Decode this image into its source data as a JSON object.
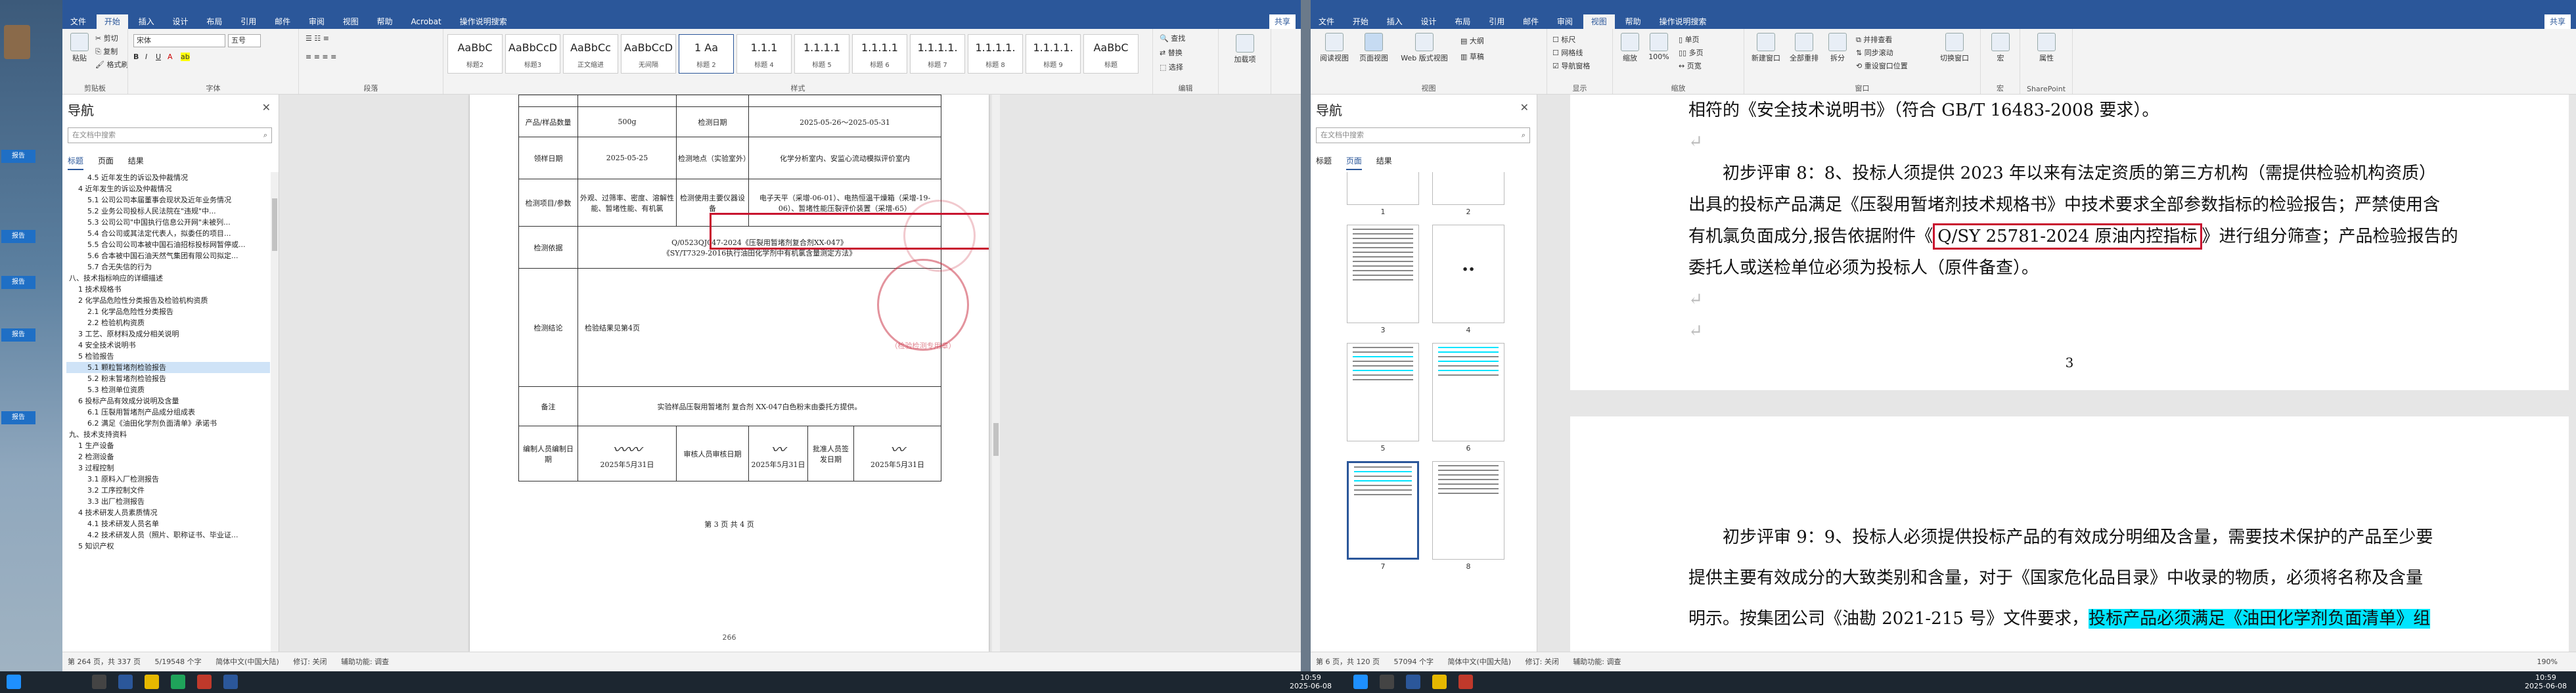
{
  "left_window": {
    "title_left": "",
    "title_right": "",
    "menu": [
      "文件",
      "开始",
      "插入",
      "设计",
      "布局",
      "引用",
      "邮件",
      "审阅",
      "视图",
      "帮助",
      "Acrobat",
      "操作说明搜索"
    ],
    "active_menu": "开始",
    "share": "共享",
    "clipboard": {
      "paste": "粘贴",
      "cut": "剪切",
      "copy": "复制",
      "format_painter": "格式刷",
      "label": "剪贴板"
    },
    "font": {
      "name": "宋体",
      "size": "五号",
      "label": "字体"
    },
    "paragraph_label": "段落",
    "styles": [
      {
        "sample": "AaBbC",
        "name": "标题2"
      },
      {
        "sample": "AaBbCcD",
        "name": "标题3"
      },
      {
        "sample": "AaBbCc",
        "name": "正文缩进"
      },
      {
        "sample": "AaBbCcD",
        "name": "无间隔"
      },
      {
        "sample": "1  Aa",
        "name": "标题 2"
      },
      {
        "sample": "1.1.1",
        "name": "标题 4"
      },
      {
        "sample": "1.1.1.1",
        "name": "标题 5"
      },
      {
        "sample": "1.1.1.1",
        "name": "标题 6"
      },
      {
        "sample": "1.1.1.1.",
        "name": "标题 7"
      },
      {
        "sample": "1.1.1.1.",
        "name": "标题 8"
      },
      {
        "sample": "1.1.1.1.",
        "name": "标题 9"
      },
      {
        "sample": "AaBbC",
        "name": "标题"
      }
    ],
    "styles_label": "样式",
    "editing": {
      "find": "查找",
      "replace": "替换",
      "select": "选择",
      "label": "编辑"
    },
    "addin": {
      "label": "加载项"
    },
    "nav": {
      "title": "导航",
      "search_placeholder": "在文档中搜索",
      "tabs": [
        "标题",
        "页面",
        "结果"
      ],
      "active_tab": "标题",
      "items": [
        "4.5 近年发生的诉讼及仲裁情况",
        "4 近年发生的诉讼及仲裁情况",
        "5.1 公司公司本届董事会现状及近年业务情况",
        "5.2 业务公司投标人民法院在\"违规\"中...",
        "5.3 公司公司\"中国执行信息公开网\"未被列...",
        "5.4 合公司或其法定代表人，拟委任的项目...",
        "5.5 合公司公司本被中国石油招标投标网暂停或...",
        "5.6 合本被中国石油天然气集团有限公司拟定...",
        "5.7 合无失信的行为",
        "八、技术指标响应的详细描述",
        "1 技术规格书",
        "2 化学品危险性分类报告及检验机构资质",
        "2.1 化学品危险性分类报告",
        "2.2 检验机构资质",
        "3 工艺、原材料及成分相关说明",
        "4 安全技术说明书",
        "5 检验报告",
        "5.1 颗粒暂堵剂检验报告",
        "5.2 粉末暂堵剂检验报告",
        "5.3 检测单位资质",
        "6 投标产品有效成分说明及含量",
        "6.1 压裂用暂堵剂产品成分组成表",
        "6.2 满足《油田化学剂负面清单》承诺书",
        "九、技术支持资料",
        "1 生产设备",
        "2 检测设备",
        "3 过程控制",
        "3.1 原料入厂检测报告",
        "3.2 工序控制文件",
        "3.3 出厂检测报告",
        "4 技术研发人员素质情况",
        "4.1 技术研发人员名单",
        "4.2 技术研发人员（照片、职称证书、毕业证...",
        "5 知识产权"
      ],
      "selected_index": 17
    },
    "report": {
      "rows": [
        {
          "c1": "产品/样品数量",
          "c2": "500g",
          "c3": "检测日期",
          "c4": "2025-05-26～2025-05-31"
        },
        {
          "c1": "领样日期",
          "c2": "2025-05-25",
          "c3": "检测地点（实验室外）",
          "c4": "化学分析室内、安监心流动模拟评价室内"
        },
        {
          "c1": "检测项目/参数",
          "c2": "外观、过筛率、密度、溶解性能、暂堵性能、有机氯",
          "c3": "检测使用主要仪器设备",
          "c4": "电子天平（采增-06-01）、电热恒温干燥箱（采增-19-06）、暂堵性能压裂评价装置（采增-65）"
        },
        {
          "c1": "检测依据",
          "c2": "Q/0523QJ047-2024《压裂用暂堵剂复合剂XX-047》",
          "c2b": "《SY/T7329-2016执行油田化学剂中有机氯含量测定方法》"
        },
        {
          "c1": "检测结论",
          "c2": "检验结果见第4页"
        },
        {
          "c1": "备注",
          "c2": "实验样品压裂用暂堵剂 复合剂 XX-047白色粉末由委托方提供。"
        },
        {
          "c1": "编制人员编制日期",
          "sig1": "",
          "d1": "2025年5月31日",
          "c3": "审核人员审核日期",
          "d2": "2025年5月31日",
          "c5": "批准人员签发日期",
          "d3": "2025年5月31日"
        }
      ],
      "stamp_text": "（检验检测专用章）",
      "footer": "第 3 页 共 4 页",
      "page_num": "266"
    },
    "status": [
      "第 264 页，共 337 页",
      "5/19548 个字",
      "简体中文(中国大陆)",
      "修订: 关闭",
      "辅助功能: 调查"
    ]
  },
  "right_window": {
    "menu": [
      "文件",
      "开始",
      "插入",
      "设计",
      "布局",
      "引用",
      "邮件",
      "审阅",
      "视图",
      "帮助",
      "操作说明搜索"
    ],
    "active_menu": "视图",
    "share": "共享",
    "views": [
      "阅读视图",
      "页面视图",
      "Web 版式视图",
      "大纲",
      "草稿"
    ],
    "show": [
      "标尺",
      "网格线",
      "导航窗格"
    ],
    "zoom": [
      "缩放",
      "100%",
      "单页",
      "多页",
      "页宽"
    ],
    "window": [
      "新建窗口",
      "全部重排",
      "拆分",
      "并排查看",
      "同步滚动",
      "重设窗口位置",
      "切换窗口"
    ],
    "macros": "宏",
    "sharepoint": "属性",
    "labels": {
      "views": "视图",
      "show": "显示",
      "zoom": "缩放",
      "window": "窗口",
      "macros": "宏",
      "sp": "SharePoint"
    },
    "nav": {
      "title": "导航",
      "search_placeholder": "在文档中搜索",
      "tabs": [
        "标题",
        "页面",
        "结果"
      ],
      "active_tab": "页面",
      "thumbs": [
        "1",
        "2",
        "3",
        "4",
        "5",
        "6",
        "7",
        "8"
      ],
      "selected_thumb": "7"
    },
    "doc": {
      "top_line": "相符的《安全技术说明书》（符合 GB/T 16483-2008 要求）。",
      "p8_a": "初步评审 8：8、投标人须提供 2023 年以来有法定资质的第三方机构（需提供检验机构资质）",
      "p8_b": "出具的投标产品满足《压裂用暂堵剂技术规格书》中技术要求全部参数指标的检验报告；严禁使用含",
      "p8_c1": "有机氯负面成分,报告依据附件《",
      "p8_c_box": "Q/SY 25781-2024 原油内控指标",
      "p8_c2": "》进行组分筛查；产品检验报告的",
      "p8_d": "委托人或送检单位必须为投标人（原件备查）。",
      "page_no": "3",
      "p9_a": "初步评审 9：9、投标人必须提供投标产品的有效成分明细及含量，需要技术保护的产品至少要",
      "p9_b": "提供主要有效成分的大致类别和含量，对于《国家危化品目录》中收录的物质，必须将名称及含量",
      "p9_c1": "明示。按集团公司《油勘 2021-215 号》文件要求，",
      "p9_c_hl": "投标产品必须满足《油田化学剂负面清单》组"
    },
    "status": [
      "第 6 页，共 120 页",
      "57094 个字",
      "简体中文(中国大陆)",
      "修订: 关闭",
      "辅助功能: 调查"
    ],
    "zoom_level": "190%"
  },
  "taskbar": {
    "time1": "10:59",
    "date1": "2025-06-08",
    "time2": "10:59",
    "date2": "2025-06-08"
  },
  "desktop_tags": [
    "报告",
    "报告",
    "报告",
    "报告",
    "报告"
  ],
  "colors": {
    "word_blue": "#2b579a",
    "highlight": "#00e5ff",
    "red_box": "#c8102e"
  }
}
